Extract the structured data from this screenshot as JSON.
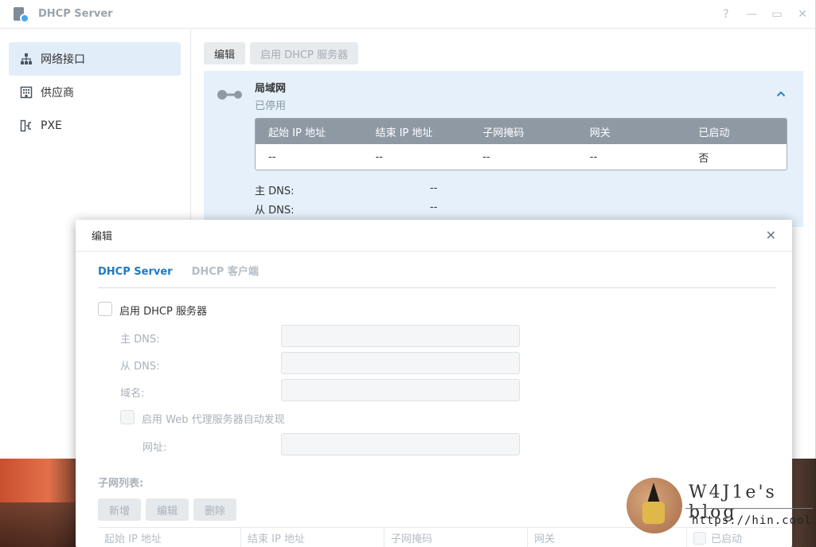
{
  "window": {
    "title": "DHCP Server",
    "controls": [
      "?",
      "—",
      "▭",
      "✕"
    ]
  },
  "sidebar": {
    "items": [
      {
        "label": "网络接口",
        "icon": "network-icon",
        "active": true
      },
      {
        "label": "供应商",
        "icon": "building-icon",
        "active": false
      },
      {
        "label": "PXE",
        "icon": "pxe-icon",
        "active": false
      }
    ]
  },
  "toolbar": {
    "edit_label": "编辑",
    "enable_label": "启用 DHCP 服务器"
  },
  "lan": {
    "title": "局域网",
    "status": "已停用",
    "columns": [
      "起始 IP 地址",
      "结束 IP 地址",
      "子网掩码",
      "网关",
      "已启动"
    ],
    "row": [
      "--",
      "--",
      "--",
      "--",
      "否"
    ],
    "primary_dns_label": "主 DNS:",
    "primary_dns_value": "--",
    "secondary_dns_label": "从 DNS:",
    "secondary_dns_value": "--"
  },
  "modal": {
    "title": "编辑",
    "close": "✕",
    "tabs": [
      "DHCP Server",
      "DHCP 客户端"
    ],
    "enable_label": "启用 DHCP 服务器",
    "primary_dns_label": "主 DNS:",
    "secondary_dns_label": "从 DNS:",
    "domain_label": "域名:",
    "proxy_label": "启用 Web 代理服务器自动发现",
    "url_label": "网址:",
    "subnet_title": "子网列表:",
    "add_label": "新增",
    "edit_label": "编辑",
    "delete_label": "删除",
    "subnet_columns": [
      "起始 IP 地址",
      "结束 IP 地址",
      "子网掩码",
      "网关",
      "已启动"
    ]
  },
  "watermark": {
    "title": "W4J1e's blog",
    "url": "https://hin.cool"
  },
  "colors": {
    "accent": "#1f7ac4",
    "panel": "#e5f0fa",
    "table_header": "#8e99a4"
  }
}
